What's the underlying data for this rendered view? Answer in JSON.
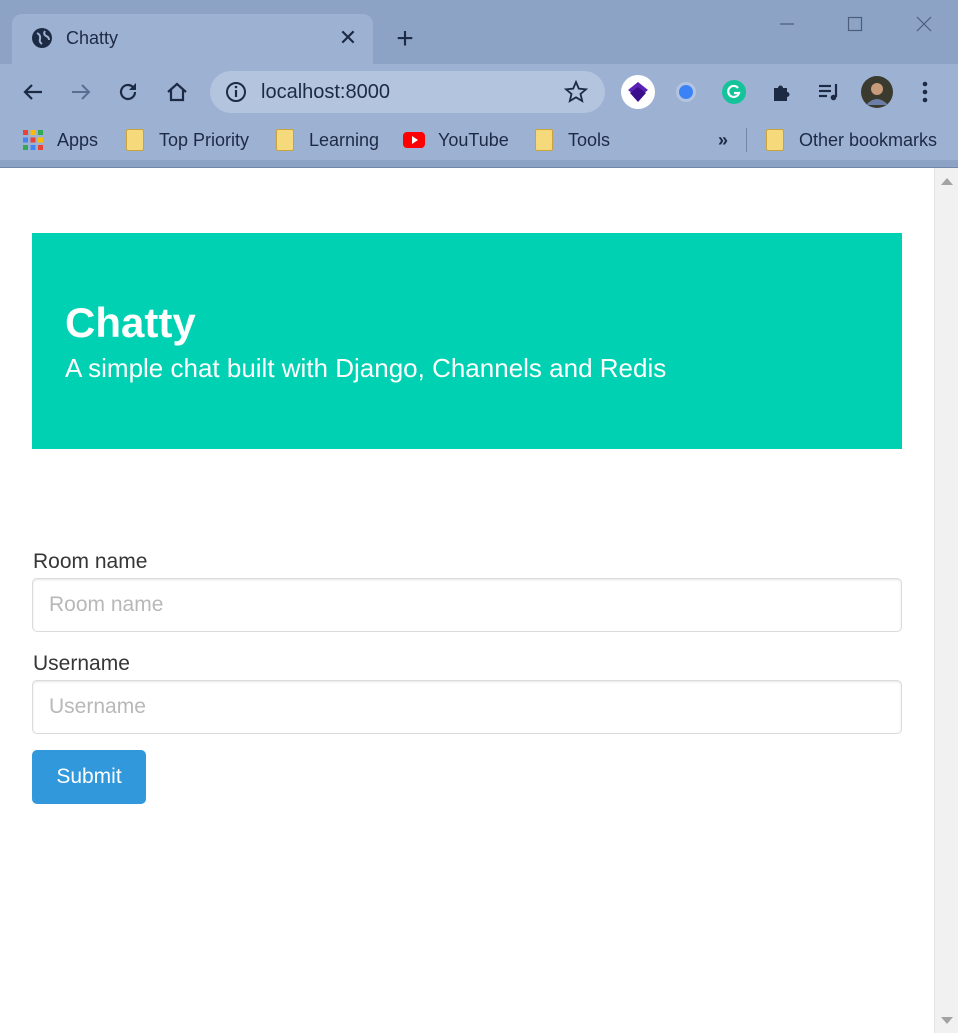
{
  "browser": {
    "tab": {
      "title": "Chatty",
      "close": "✕"
    },
    "new_tab": "+",
    "address": "localhost:8000",
    "bookmarks": [
      {
        "label": "Apps",
        "icon": "apps-grid-icon"
      },
      {
        "label": "Top Priority",
        "icon": "folder-icon"
      },
      {
        "label": "Learning",
        "icon": "folder-icon"
      },
      {
        "label": "YouTube",
        "icon": "youtube-icon"
      },
      {
        "label": "Tools",
        "icon": "folder-icon"
      }
    ],
    "bookmarks_overflow": "»",
    "other_bookmarks": "Other bookmarks"
  },
  "hero": {
    "title": "Chatty",
    "subtitle": "A simple chat built with Django, Channels and Redis",
    "color": "#00d1b2"
  },
  "form": {
    "room": {
      "label": "Room name",
      "placeholder": "Room name"
    },
    "username": {
      "label": "Username",
      "placeholder": "Username"
    },
    "submit": "Submit",
    "submit_color": "#3298dc"
  }
}
